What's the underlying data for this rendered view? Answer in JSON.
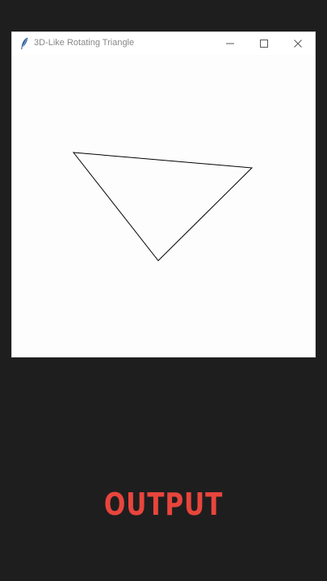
{
  "window": {
    "title": "3D-Like Rotating Triangle",
    "controls": {
      "minimize_icon": "minimize-icon",
      "maximize_icon": "maximize-icon",
      "close_icon": "close-icon"
    }
  },
  "triangle": {
    "stroke_color": "#000000"
  },
  "caption": {
    "text": "OUTPUT",
    "color": "#e8453c"
  },
  "colors": {
    "page_background": "#1f1e1f",
    "window_background": "#ffffff"
  }
}
